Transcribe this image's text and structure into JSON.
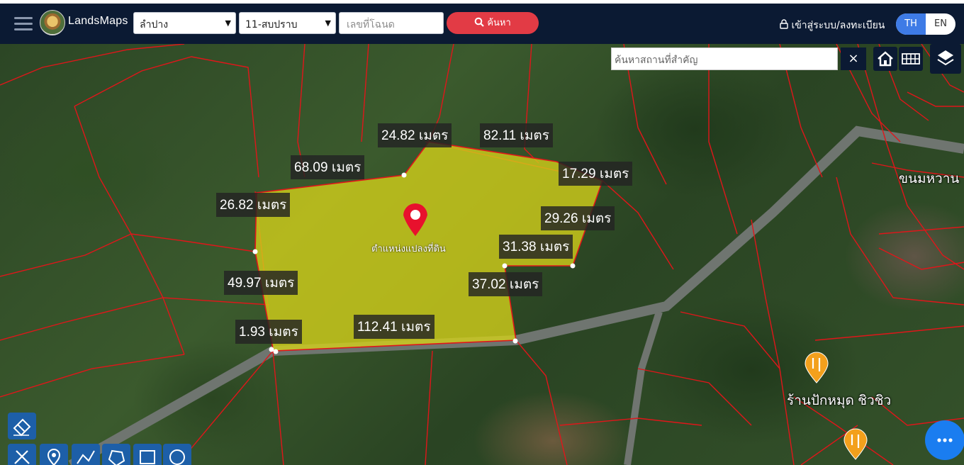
{
  "header": {
    "brand": "LandsMaps",
    "province_select": "ลำปาง",
    "district_select": "11-สบปราบ",
    "deed_placeholder": "เลขที่โฉนด",
    "search_label": "ค้นหา",
    "login_label": "เข้าสู่ระบบ/ลงทะเบียน",
    "lang_th": "TH",
    "lang_en": "EN"
  },
  "map": {
    "place_search_placeholder": "ค้นหาสถานที่สำคัญ",
    "close_label": "×",
    "pin_label": "ตำแหน่งแปลงที่ดิน",
    "village_label": "ขนมหวาน",
    "poi_label": "ร้านปักหมุด ชิวชิว",
    "parcel_fill_color": "#d6d21a",
    "boundary_color": "#e0161a",
    "measurements": [
      "24.82 เมตร",
      "82.11 เมตร",
      "68.09 เมตร",
      "17.29 เมตร",
      "26.82 เมตร",
      "29.26 เมตร",
      "31.38 เมตร",
      "49.97 เมตร",
      "37.02 เมตร",
      "112.41 เมตร",
      "1.93 เมตร"
    ]
  },
  "tools": {
    "icons": [
      "eraser-icon",
      "ruler-icon",
      "marker-icon",
      "polyline-icon",
      "polygon-icon",
      "rectangle-icon",
      "circle-icon"
    ]
  },
  "fab": {
    "icon": "more-icon",
    "color": "#1a7df0"
  }
}
